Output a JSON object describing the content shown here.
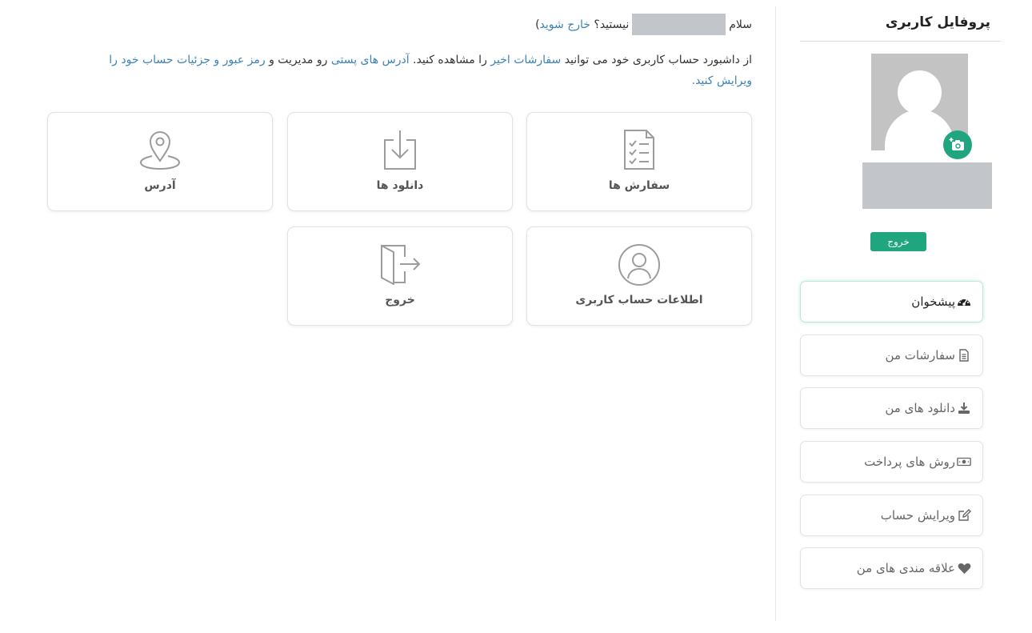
{
  "sidebar": {
    "title": "پروفایل کاربری",
    "logout_label": "خروج",
    "items": [
      {
        "label": "پیشخوان",
        "icon": "dashboard-icon"
      },
      {
        "label": "سفارشات من",
        "icon": "document-icon"
      },
      {
        "label": "دانلود های من",
        "icon": "download-icon"
      },
      {
        "label": "روش های پرداخت",
        "icon": "money-icon"
      },
      {
        "label": "ویرایش حساب",
        "icon": "edit-icon"
      },
      {
        "label": "علاقه مندی های من",
        "icon": "heart-icon"
      }
    ]
  },
  "main": {
    "greeting": {
      "hello": "سلام",
      "not_you": "نیستید؟",
      "logout_link": "خارج شوید",
      "close_paren": ")"
    },
    "intro": {
      "part1": "از داشبورد حساب کاربری خود می توانید ",
      "link_orders": "سفارشات اخیر",
      "part2": " را مشاهده کنید. ",
      "link_addresses": "آدرس های پستی",
      "part3": " رو مدیریت و ",
      "link_account": "رمز عبور و جزئیات حساب خود را ویرایش کنید",
      "part4": "."
    },
    "cards": [
      {
        "label": "سفارش ها",
        "icon": "checklist-icon"
      },
      {
        "label": "دانلود ها",
        "icon": "download-box-icon"
      },
      {
        "label": "آدرس",
        "icon": "location-pin-icon"
      },
      {
        "label": "اطلاعات حساب کاربری",
        "icon": "user-circle-icon"
      },
      {
        "label": "خروج",
        "icon": "exit-door-icon"
      }
    ]
  },
  "colors": {
    "accent": "#1fa67f",
    "link": "#3b82b8",
    "placeholder": "#c2c5c9"
  }
}
